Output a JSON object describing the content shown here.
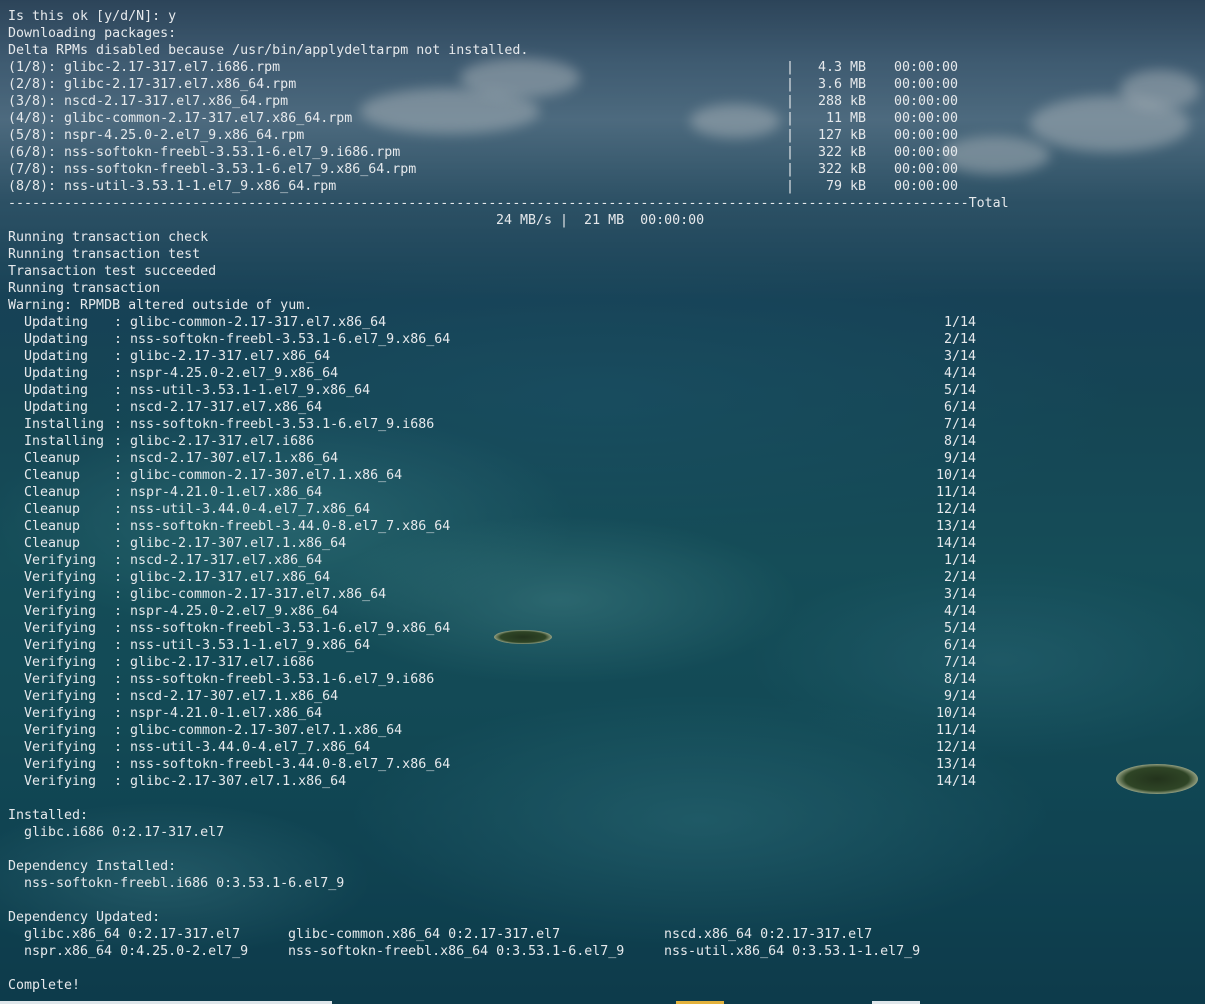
{
  "prompt_line": "Is this ok [y/d/N]: y",
  "downloading_header": "Downloading packages:",
  "delta_notice": "Delta RPMs disabled because /usr/bin/applydeltarpm not installed.",
  "downloads": [
    {
      "name": "(1/8): glibc-2.17-317.el7.i686.rpm",
      "size": "4.3 MB",
      "time": "00:00:00"
    },
    {
      "name": "(2/8): glibc-2.17-317.el7.x86_64.rpm",
      "size": "3.6 MB",
      "time": "00:00:00"
    },
    {
      "name": "(3/8): nscd-2.17-317.el7.x86_64.rpm",
      "size": "288 kB",
      "time": "00:00:00"
    },
    {
      "name": "(4/8): glibc-common-2.17-317.el7.x86_64.rpm",
      "size": "11 MB",
      "time": "00:00:00"
    },
    {
      "name": "(5/8): nspr-4.25.0-2.el7_9.x86_64.rpm",
      "size": "127 kB",
      "time": "00:00:00"
    },
    {
      "name": "(6/8): nss-softokn-freebl-3.53.1-6.el7_9.i686.rpm",
      "size": "322 kB",
      "time": "00:00:00"
    },
    {
      "name": "(7/8): nss-softokn-freebl-3.53.1-6.el7_9.x86_64.rpm",
      "size": "322 kB",
      "time": "00:00:00"
    },
    {
      "name": "(8/8): nss-util-3.53.1-1.el7_9.x86_64.rpm",
      "size": "79 kB",
      "time": "00:00:00"
    }
  ],
  "total_label": "Total",
  "total_summary": "24 MB/s |  21 MB  00:00:00",
  "status_lines": [
    "Running transaction check",
    "Running transaction test",
    "Transaction test succeeded",
    "Running transaction",
    "Warning: RPMDB altered outside of yum."
  ],
  "transaction": [
    {
      "action": "Updating",
      "pkg": "glibc-common-2.17-317.el7.x86_64",
      "count": "1/14"
    },
    {
      "action": "Updating",
      "pkg": "nss-softokn-freebl-3.53.1-6.el7_9.x86_64",
      "count": "2/14"
    },
    {
      "action": "Updating",
      "pkg": "glibc-2.17-317.el7.x86_64",
      "count": "3/14"
    },
    {
      "action": "Updating",
      "pkg": "nspr-4.25.0-2.el7_9.x86_64",
      "count": "4/14"
    },
    {
      "action": "Updating",
      "pkg": "nss-util-3.53.1-1.el7_9.x86_64",
      "count": "5/14"
    },
    {
      "action": "Updating",
      "pkg": "nscd-2.17-317.el7.x86_64",
      "count": "6/14"
    },
    {
      "action": "Installing",
      "pkg": "nss-softokn-freebl-3.53.1-6.el7_9.i686",
      "count": "7/14"
    },
    {
      "action": "Installing",
      "pkg": "glibc-2.17-317.el7.i686",
      "count": "8/14"
    },
    {
      "action": "Cleanup",
      "pkg": "nscd-2.17-307.el7.1.x86_64",
      "count": "9/14"
    },
    {
      "action": "Cleanup",
      "pkg": "glibc-common-2.17-307.el7.1.x86_64",
      "count": "10/14"
    },
    {
      "action": "Cleanup",
      "pkg": "nspr-4.21.0-1.el7.x86_64",
      "count": "11/14"
    },
    {
      "action": "Cleanup",
      "pkg": "nss-util-3.44.0-4.el7_7.x86_64",
      "count": "12/14"
    },
    {
      "action": "Cleanup",
      "pkg": "nss-softokn-freebl-3.44.0-8.el7_7.x86_64",
      "count": "13/14"
    },
    {
      "action": "Cleanup",
      "pkg": "glibc-2.17-307.el7.1.x86_64",
      "count": "14/14"
    },
    {
      "action": "Verifying",
      "pkg": "nscd-2.17-317.el7.x86_64",
      "count": "1/14"
    },
    {
      "action": "Verifying",
      "pkg": "glibc-2.17-317.el7.x86_64",
      "count": "2/14"
    },
    {
      "action": "Verifying",
      "pkg": "glibc-common-2.17-317.el7.x86_64",
      "count": "3/14"
    },
    {
      "action": "Verifying",
      "pkg": "nspr-4.25.0-2.el7_9.x86_64",
      "count": "4/14"
    },
    {
      "action": "Verifying",
      "pkg": "nss-softokn-freebl-3.53.1-6.el7_9.x86_64",
      "count": "5/14"
    },
    {
      "action": "Verifying",
      "pkg": "nss-util-3.53.1-1.el7_9.x86_64",
      "count": "6/14"
    },
    {
      "action": "Verifying",
      "pkg": "glibc-2.17-317.el7.i686",
      "count": "7/14"
    },
    {
      "action": "Verifying",
      "pkg": "nss-softokn-freebl-3.53.1-6.el7_9.i686",
      "count": "8/14"
    },
    {
      "action": "Verifying",
      "pkg": "nscd-2.17-307.el7.1.x86_64",
      "count": "9/14"
    },
    {
      "action": "Verifying",
      "pkg": "nspr-4.21.0-1.el7.x86_64",
      "count": "10/14"
    },
    {
      "action": "Verifying",
      "pkg": "glibc-common-2.17-307.el7.1.x86_64",
      "count": "11/14"
    },
    {
      "action": "Verifying",
      "pkg": "nss-util-3.44.0-4.el7_7.x86_64",
      "count": "12/14"
    },
    {
      "action": "Verifying",
      "pkg": "nss-softokn-freebl-3.44.0-8.el7_7.x86_64",
      "count": "13/14"
    },
    {
      "action": "Verifying",
      "pkg": "glibc-2.17-307.el7.1.x86_64",
      "count": "14/14"
    }
  ],
  "installed": {
    "header": "Installed:",
    "items": [
      "glibc.i686 0:2.17-317.el7"
    ]
  },
  "dependency_installed": {
    "header": "Dependency Installed:",
    "items": [
      "nss-softokn-freebl.i686 0:3.53.1-6.el7_9"
    ]
  },
  "dependency_updated": {
    "header": "Dependency Updated:",
    "rows": [
      [
        "glibc.x86_64 0:2.17-317.el7",
        "glibc-common.x86_64 0:2.17-317.el7",
        "nscd.x86_64 0:2.17-317.el7"
      ],
      [
        "nspr.x86_64 0:4.25.0-2.el7_9",
        "nss-softokn-freebl.x86_64 0:3.53.1-6.el7_9",
        "nss-util.x86_64 0:3.53.1-1.el7_9"
      ]
    ]
  },
  "complete": "Complete!",
  "colors": {
    "text": "#e6e9ec",
    "sea": "#1a6673",
    "sky": "#557996"
  }
}
